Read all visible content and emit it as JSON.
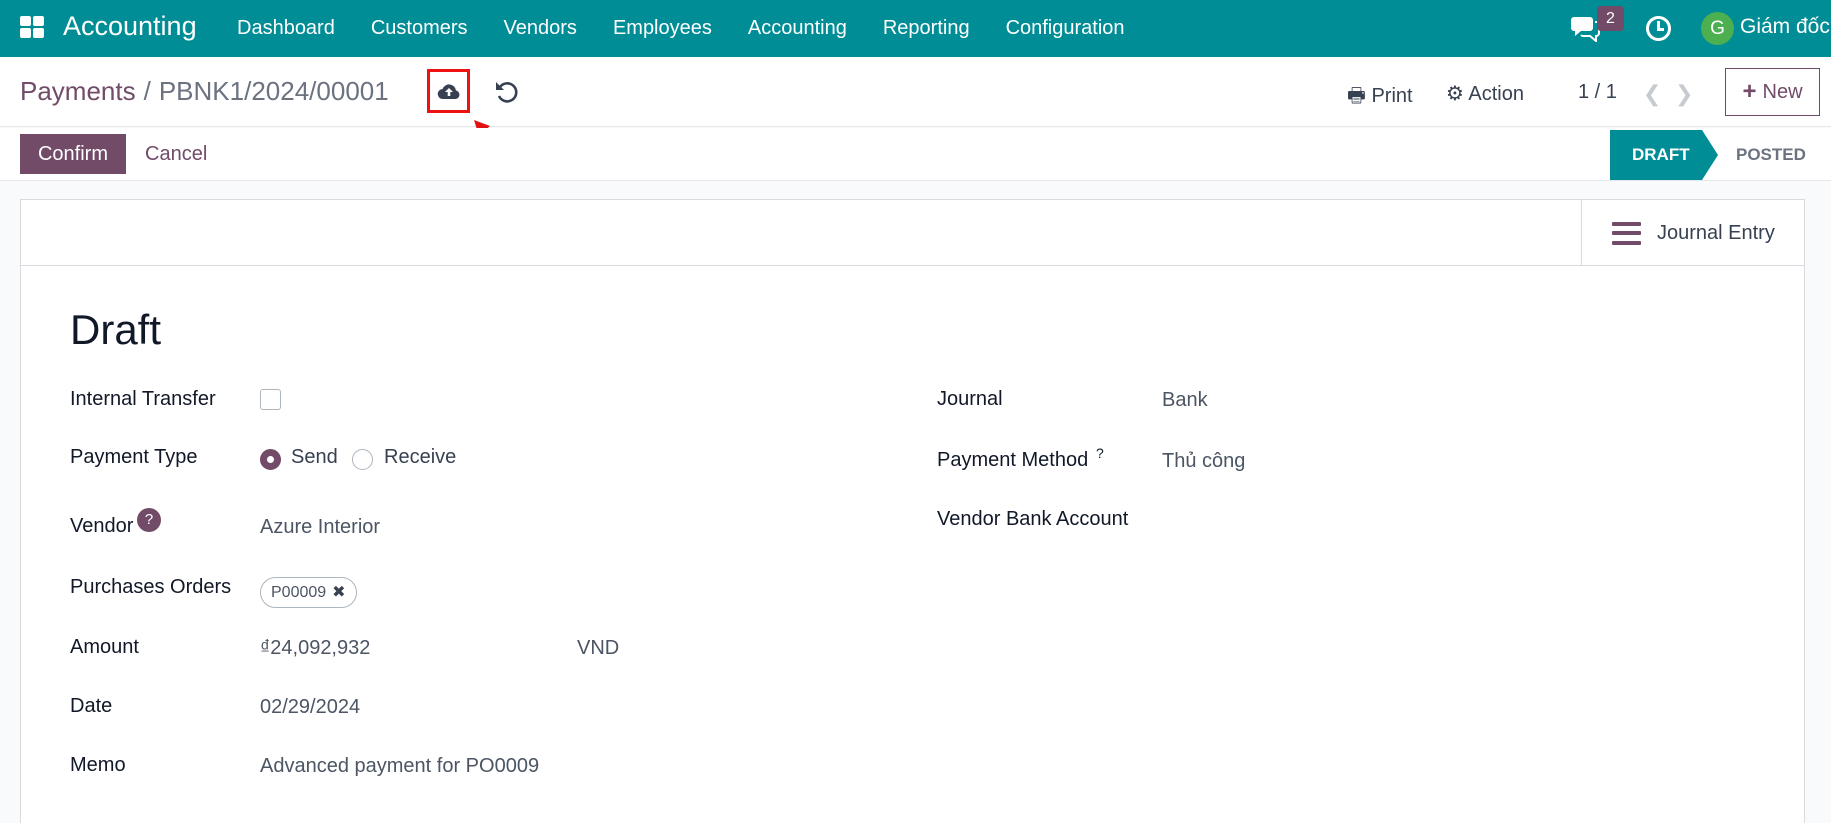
{
  "navbar": {
    "app_title": "Accounting",
    "menu": [
      "Dashboard",
      "Customers",
      "Vendors",
      "Employees",
      "Accounting",
      "Reporting",
      "Configuration"
    ],
    "chat_badge": "2",
    "avatar_letter": "G",
    "user_name": "Giám đốc",
    "background_color": "#018d95"
  },
  "control_panel": {
    "breadcrumb_parent": "Payments",
    "breadcrumb_separator": "/",
    "breadcrumb_current": "PBNK1/2024/00001",
    "print_label": "Print",
    "action_label": "Action",
    "pager": "1 / 1",
    "new_label": "New"
  },
  "statusbar": {
    "confirm_label": "Confirm",
    "cancel_label": "Cancel",
    "stages": [
      "DRAFT",
      "POSTED"
    ],
    "active_stage": "DRAFT"
  },
  "sheet": {
    "journal_entry_label": "Journal Entry",
    "title": "Draft",
    "left": {
      "internal_transfer_label": "Internal Transfer",
      "internal_transfer_checked": false,
      "payment_type_label": "Payment Type",
      "payment_type_options": [
        "Send",
        "Receive"
      ],
      "payment_type_selected": "Send",
      "vendor_label": "Vendor",
      "vendor_help": "?",
      "vendor_value": "Azure Interior",
      "purchase_orders_label": "Purchases Orders",
      "purchase_order_tag": "P00009",
      "amount_label": "Amount",
      "amount_value": "₫24,092,932",
      "currency": "VND",
      "date_label": "Date",
      "date_value": "02/29/2024",
      "memo_label": "Memo",
      "memo_value": "Advanced payment for PO0009"
    },
    "right": {
      "journal_label": "Journal",
      "journal_value": "Bank",
      "payment_method_label": "Payment Method",
      "payment_method_help": "?",
      "payment_method_value": "Thủ công",
      "vendor_bank_account_label": "Vendor Bank Account"
    }
  },
  "colors": {
    "brand_purple": "#714b67",
    "teal": "#018d95",
    "annotation_red": "#e11111"
  }
}
